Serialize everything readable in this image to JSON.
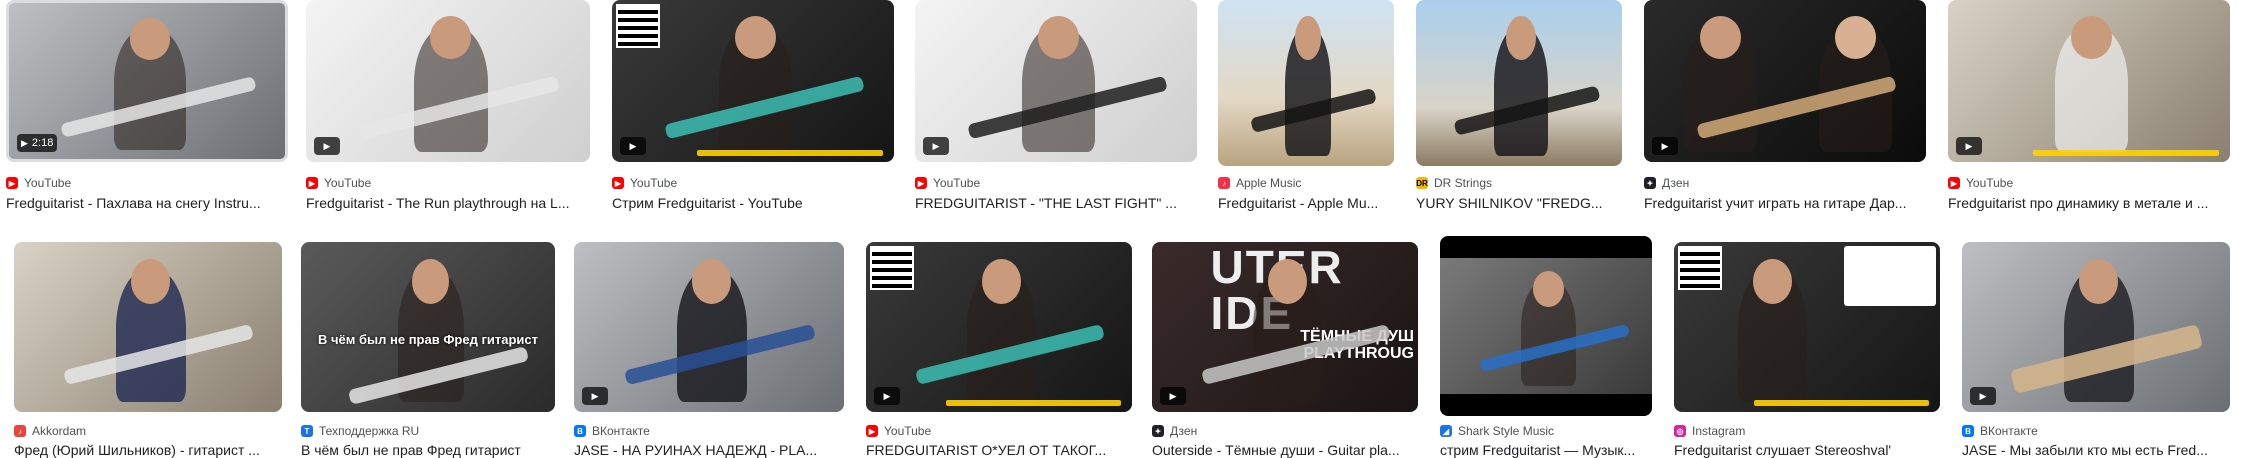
{
  "colors": {
    "youtube": "#ff0000",
    "apple": "#fa2d48",
    "dr": "#f5b800",
    "dzen": "#202124",
    "akkordam": "#e8453c",
    "techsupport": "#1a73e8",
    "vk": "#0077ff",
    "shark": "#1a73e8",
    "instagram": "#d6249f"
  },
  "row1": [
    {
      "source": "YouTube",
      "title": "Fredguitarist - Пахлава на снегу Instru...",
      "duration": "2:18",
      "icon": "youtube-icon"
    },
    {
      "source": "YouTube",
      "title": "Fredguitarist - The Run playthrough на L...",
      "duration": "",
      "icon": "youtube-icon"
    },
    {
      "source": "YouTube",
      "title": "Стрим Fredguitarist - YouTube",
      "duration": "",
      "icon": "youtube-icon"
    },
    {
      "source": "YouTube",
      "title": "FREDGUITARIST - \"THE LAST FIGHT\" ...",
      "duration": "",
      "icon": "youtube-icon"
    },
    {
      "source": "Apple Music",
      "title": "Fredguitarist - Apple Mu...",
      "duration": "",
      "icon": "apple-music-icon"
    },
    {
      "source": "DR Strings",
      "title": "YURY SHILNIKOV \"FREDG...",
      "duration": "",
      "icon": "dr-strings-icon"
    },
    {
      "source": "Дзен",
      "title": "Fredguitarist учит играть на гитаре Дар...",
      "duration": "",
      "icon": "dzen-icon"
    },
    {
      "source": "YouTube",
      "title": "Fredguitarist про динамику в метале и ...",
      "duration": "",
      "icon": "youtube-icon"
    }
  ],
  "row2": [
    {
      "source": "Akkordam",
      "title": "Фред (Юрий Шильников) - гитарист ...",
      "icon": "akkordam-icon"
    },
    {
      "source": "Техподдержка RU",
      "title": "В чём был не прав Фред гитарист",
      "icon": "techsupport-icon",
      "overlay": "В чём был не прав Фред гитарист"
    },
    {
      "source": "ВКонтакте",
      "title": "JASE - НА РУИНАХ НАДЕЖД - PLA...",
      "icon": "vk-icon"
    },
    {
      "source": "YouTube",
      "title": "FREDGUITARIST О*УЕЛ ОТ ТАКОГ...",
      "icon": "youtube-icon"
    },
    {
      "source": "Дзен",
      "title": "Outerside - Тёмные души - Guitar pla...",
      "icon": "dzen-icon",
      "overlay_big": "UTER\nIDE",
      "overlay_sub": "ТЁМНЫЕ ДУШ\nPLAYTHROUG"
    },
    {
      "source": "Shark Style Music",
      "title": "стрим Fredguitarist — Музык...",
      "icon": "shark-icon"
    },
    {
      "source": "Instagram",
      "title": "Fredguitarist слушает Stereoshval'",
      "icon": "instagram-icon"
    },
    {
      "source": "ВКонтакте",
      "title": "JASE - Мы забыли кто мы есть Fred...",
      "icon": "vk-icon"
    }
  ]
}
